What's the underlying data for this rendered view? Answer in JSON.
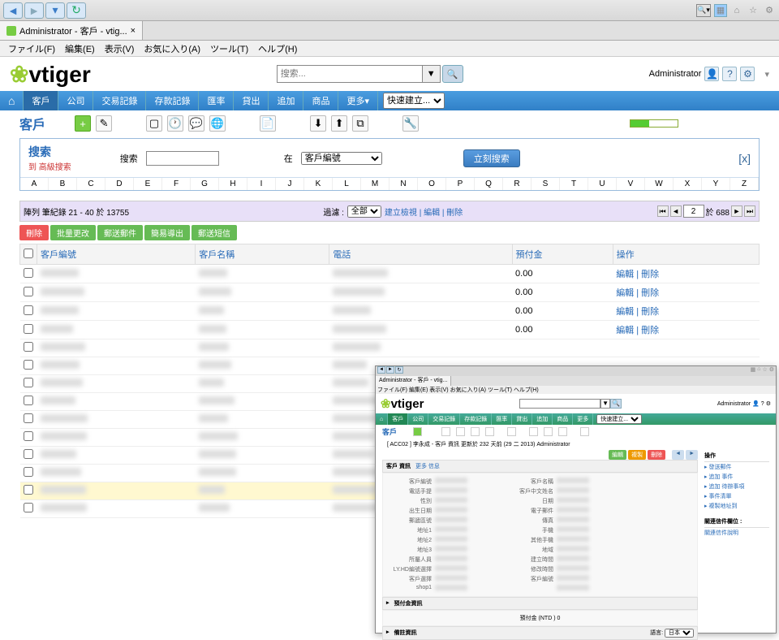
{
  "browser": {
    "tab_title": "Administrator - 客戶 - vtig...",
    "menu": [
      "ファイル(F)",
      "編集(E)",
      "表示(V)",
      "お気に入り(A)",
      "ツール(T)",
      "ヘルプ(H)"
    ]
  },
  "header": {
    "logo": "vtiger",
    "search_placeholder": "搜索...",
    "user": "Administrator"
  },
  "nav": {
    "tabs": [
      "客戶",
      "公司",
      "交易記錄",
      "存款記錄",
      "匯率",
      "貸出",
      "追加",
      "商品",
      "更多"
    ],
    "quick_label": "快速建立..."
  },
  "module": {
    "title": "客戶"
  },
  "search_panel": {
    "title": "搜索",
    "adv_link": "到 高級搜索",
    "label_search": "搜索",
    "label_in": "在",
    "in_option": "客戶編號",
    "submit": "立刻搜索",
    "alphabet": [
      "A",
      "B",
      "C",
      "D",
      "E",
      "F",
      "G",
      "H",
      "I",
      "J",
      "K",
      "L",
      "M",
      "N",
      "O",
      "P",
      "Q",
      "R",
      "S",
      "T",
      "U",
      "V",
      "W",
      "X",
      "Y",
      "Z"
    ]
  },
  "list": {
    "summary": "陣列 筆紀錄 21 - 40 於 13755",
    "filter_label": "過濾 :",
    "filter_option": "全部",
    "filter_links": "建立檢視 | 編輯 | 刪除",
    "page_input": "2",
    "page_total": "於 688",
    "actions": [
      "刪除",
      "批量更改",
      "郵送郵件",
      "簡易導出",
      "郵送短信"
    ],
    "columns": [
      "",
      "客戶編號",
      "客戶名稱",
      "電話",
      "預付金",
      "操作"
    ],
    "operate": "編輯 | 刪除",
    "rows": [
      {
        "deposit": "0.00"
      },
      {
        "deposit": "0.00"
      },
      {
        "deposit": "0.00"
      },
      {
        "deposit": "0.00"
      },
      {
        "deposit": ""
      },
      {
        "deposit": ""
      },
      {
        "deposit": ""
      },
      {
        "deposit": ""
      },
      {
        "deposit": ""
      },
      {
        "deposit": ""
      },
      {
        "deposit": ""
      },
      {
        "deposit": ""
      },
      {
        "deposit": ""
      },
      {
        "deposit": ""
      }
    ],
    "highlighted_row": 12
  },
  "overlay": {
    "tab": "Administrator - 客戶 - vtig...",
    "menu": [
      "ファイル(F)",
      "編集(E)",
      "表示(V)",
      "お気に入り(A)",
      "ツール(T)",
      "ヘルプ(H)"
    ],
    "logo": "vtiger",
    "user": "Administrator",
    "nav": [
      "客戶",
      "公司",
      "交易記錄",
      "存款記錄",
      "匯率",
      "貸出",
      "追加",
      "商品",
      "更多"
    ],
    "module": "客戶",
    "crumb": "[ ACC02 ] 李永成 - 客戶 資訊  更新於 232 天前 (29 二 2013) Administrator",
    "block1_tab1": "客戶 資訊",
    "block1_tab2": "更多 信息",
    "top_actions": [
      "編輯",
      "複製",
      "刪除"
    ],
    "fields_left": [
      "客戶編號",
      "電話手提",
      "性別",
      "出生日期",
      "郵遞區號",
      "地址1",
      "地址2",
      "地址3",
      "所屬人員",
      "LY.HD編號選擇",
      "客戶選擇",
      "shop1"
    ],
    "fields_right": [
      "客戶名稱",
      "客戶中文姓名",
      "日期",
      "電子郵件",
      "傳真",
      "手機",
      "其他手機",
      "地域",
      "建立時間",
      "修改時間",
      "客戶編號"
    ],
    "block2": "預付金資訊",
    "deposit_label": "預付金 (NTD )",
    "deposit_val": "0",
    "block3": "備註資訊",
    "lang_label": "語言:",
    "lang_opt": "日本",
    "side_hdr1": "操作",
    "side_links": [
      "發送郵件",
      "追加 事件",
      "追加 待辦事項",
      "事件清單",
      "複製地址到"
    ],
    "side_hdr2": "關連信件欄位 :",
    "side_link2": "關連信件說明"
  }
}
